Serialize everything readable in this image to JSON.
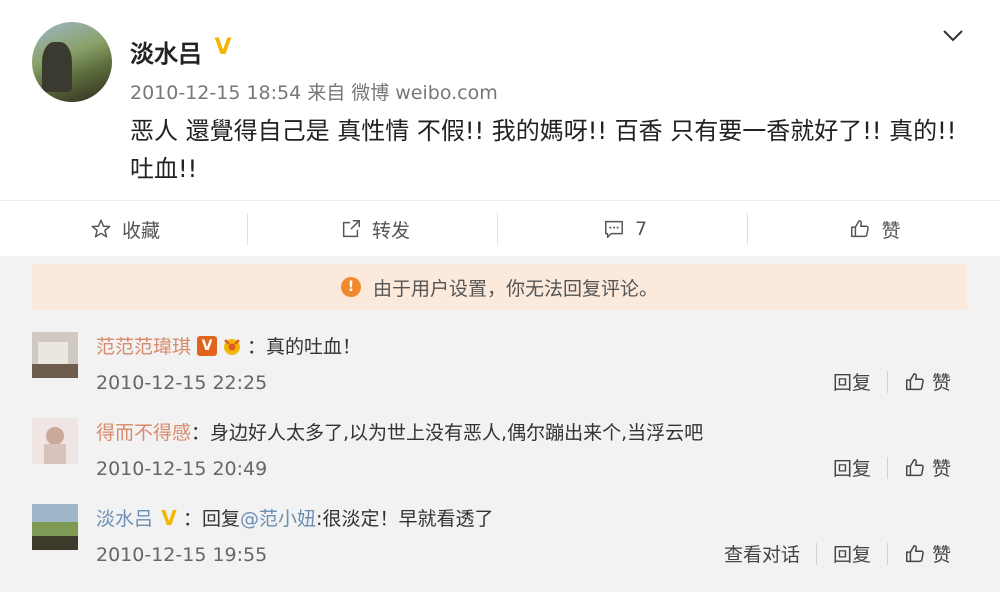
{
  "post": {
    "username": "淡水吕",
    "verified_badge": "V",
    "timestamp": "2010-12-15 18:54",
    "source_prefix": "来自",
    "source_app": "微博",
    "source_site": "weibo.com",
    "content": "恶人 還覺得自己是 真性情  不假!! 我的媽呀!!  百香  只有要一香就好了!! 真的!! 吐血!!"
  },
  "actions": {
    "favorite_label": "收藏",
    "repost_label": "转发",
    "comment_count": "7",
    "like_label": "赞",
    "icons": [
      "star-icon",
      "share-icon",
      "comment-icon",
      "thumbs-up-icon"
    ]
  },
  "notice": {
    "text": "由于用户设置，你无法回复评论。",
    "icon": "!"
  },
  "comments": [
    {
      "name": "范范范瑋琪",
      "badge": "V",
      "text": "：真的吐血！",
      "time": "2010-12-15 22:25",
      "reply_label": "回复",
      "like_label": "赞"
    },
    {
      "name": "得而不得感",
      "text": "：身边好人太多了,以为世上没有恶人,偶尔蹦出来个,当浮云吧",
      "time": "2010-12-15 20:49",
      "reply_label": "回复",
      "like_label": "赞"
    },
    {
      "name": "淡水吕",
      "badge": "V",
      "reply_prefix": "：回复 ",
      "mention": "@范小妞",
      "text": ":很淡定！早就看透了",
      "time": "2010-12-15 19:55",
      "view_conversation_label": "查看对话",
      "reply_label": "回复",
      "like_label": "赞"
    }
  ],
  "colors": {
    "notice_bg": "#fbe9dc",
    "notice_icon": "#f08a2c",
    "verified_gold": "#f2b705",
    "comment_bg": "#f2f2f2"
  }
}
